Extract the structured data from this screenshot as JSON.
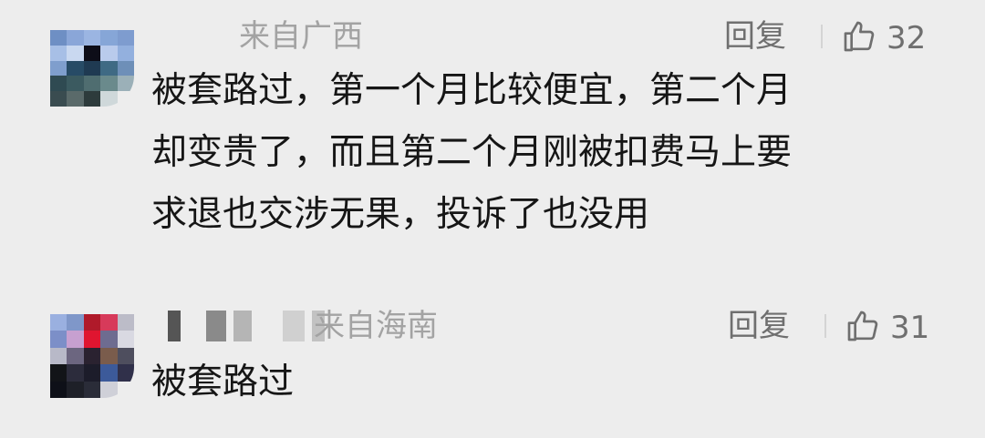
{
  "comments": [
    {
      "location": "来自广西",
      "reply_label": "回复",
      "like_count": "32",
      "text": "被套路过，第一个月比较便宜，第二个月\n却变贵了，而且第二个月刚被扣费马上要\n求退也交涉无果，投诉了也没用",
      "avatar_colors": [
        "#6e8fc4",
        "#8aa6d8",
        "#9bb5e2",
        "#86a6d7",
        "#7e9ccf",
        "#a7bfe6",
        "#c9d8f0",
        "#0d0d18",
        "#b9cbec",
        "#93b0de",
        "#7f9ecd",
        "#274b66",
        "#1f3a52",
        "#3f6a84",
        "#6e8fb8",
        "#2f4a52",
        "#3b5a60",
        "#4f6d70",
        "#6a8a8c",
        "#9bb0b8",
        "#3a4c50",
        "#5a6a6a",
        "#2d3b3c",
        "#cfd8da",
        "#ededed"
      ]
    },
    {
      "location": "来自海南",
      "reply_label": "回复",
      "like_count": "31",
      "text": "被套路过",
      "avatar_colors": [
        "#9ab0e0",
        "#7f97c9",
        "#b01a2a",
        "#d73a5a",
        "#bcbcc8",
        "#7c8fc8",
        "#c7a0d0",
        "#e01530",
        "#6e6c90",
        "#d9d9e2",
        "#b8b9c8",
        "#6c6680",
        "#2a2230",
        "#7a5c4c",
        "#4e4e5e",
        "#121418",
        "#2c2c3c",
        "#1c1c2a",
        "#3c5a9a",
        "#30304a",
        "#0e1018",
        "#1e2028",
        "#2a2c38",
        "#cfd0d8",
        "#ededed"
      ]
    }
  ],
  "icons": {
    "like": "thumbs-up-outline-icon"
  },
  "colors": {
    "background": "#ededed",
    "meta_text": "#a3a3a3",
    "action_text": "#6f6f6f",
    "body_text": "#161616"
  }
}
